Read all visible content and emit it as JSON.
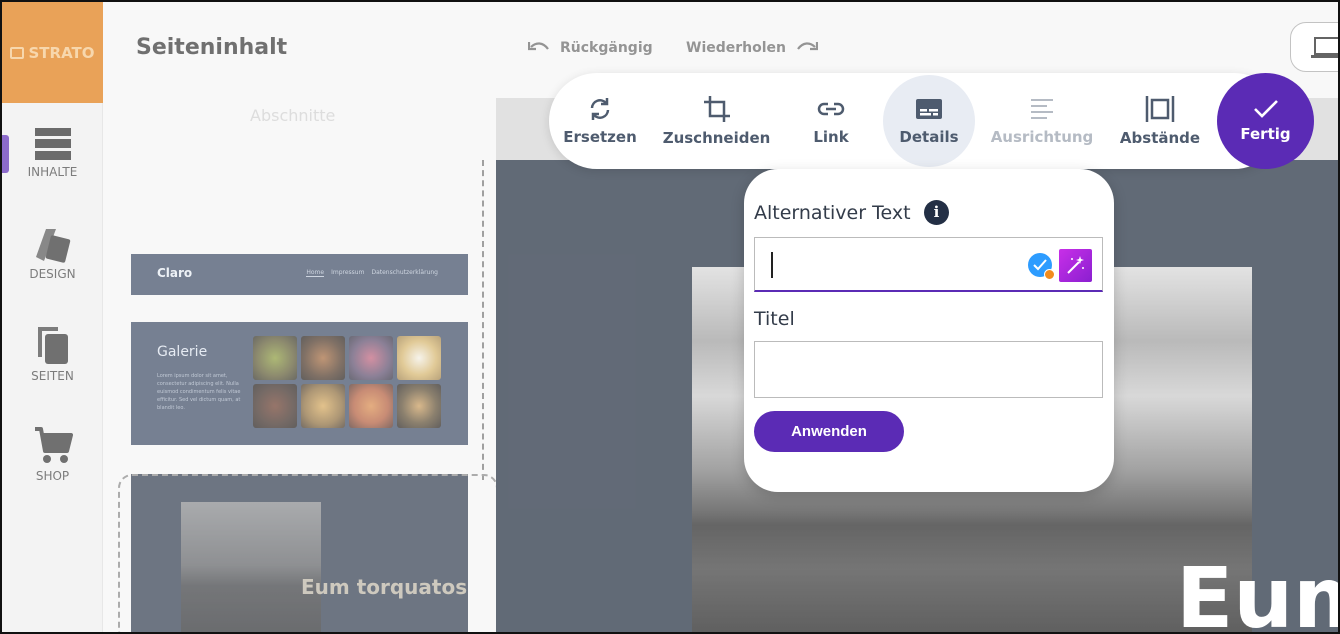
{
  "logo": {
    "text": "STRATO"
  },
  "sidebar": {
    "items": [
      {
        "label": "INHALTE",
        "icon": "content-icon",
        "active": true
      },
      {
        "label": "DESIGN",
        "icon": "design-icon"
      },
      {
        "label": "SEITEN",
        "icon": "pages-icon"
      },
      {
        "label": "SHOP",
        "icon": "cart-icon"
      }
    ]
  },
  "header": {
    "title": "Seiteninhalt",
    "undo_label": "Rückgängig",
    "redo_label": "Wiederholen"
  },
  "sections_panel": {
    "heading": "Abschnitte",
    "header_card": {
      "site_name": "Claro",
      "nav": [
        "Home",
        "Impressum",
        "Datenschutzerklärung"
      ]
    },
    "gallery_card": {
      "title": "Galerie",
      "text": "Lorem ipsum dolor sit amet, consectetur adipiscing elit. Nulla euismod condimentum felis vitae efficitur. Sed vel dictum quam, at blandit leo."
    },
    "hero_card": {
      "text": "Eum torquatos"
    }
  },
  "canvas": {
    "heading_text": "Eum"
  },
  "toolbar": {
    "items": [
      {
        "label": "Ersetzen",
        "icon": "replace-icon"
      },
      {
        "label": "Zuschneiden",
        "icon": "crop-icon"
      },
      {
        "label": "Link",
        "icon": "link-icon"
      },
      {
        "label": "Details",
        "icon": "details-icon",
        "active": true
      },
      {
        "label": "Ausrichtung",
        "icon": "align-icon",
        "disabled": true
      },
      {
        "label": "Abstände",
        "icon": "spacing-icon"
      }
    ],
    "done_label": "Fertig"
  },
  "details_popover": {
    "alt_text_label": "Alternativer Text",
    "alt_text_value": "",
    "title_label": "Titel",
    "title_value": "",
    "apply_label": "Anwenden"
  },
  "colors": {
    "accent": "#5b2bb5",
    "logo_bg": "#e07a10",
    "canvas_bg": "#1e2a3c"
  }
}
